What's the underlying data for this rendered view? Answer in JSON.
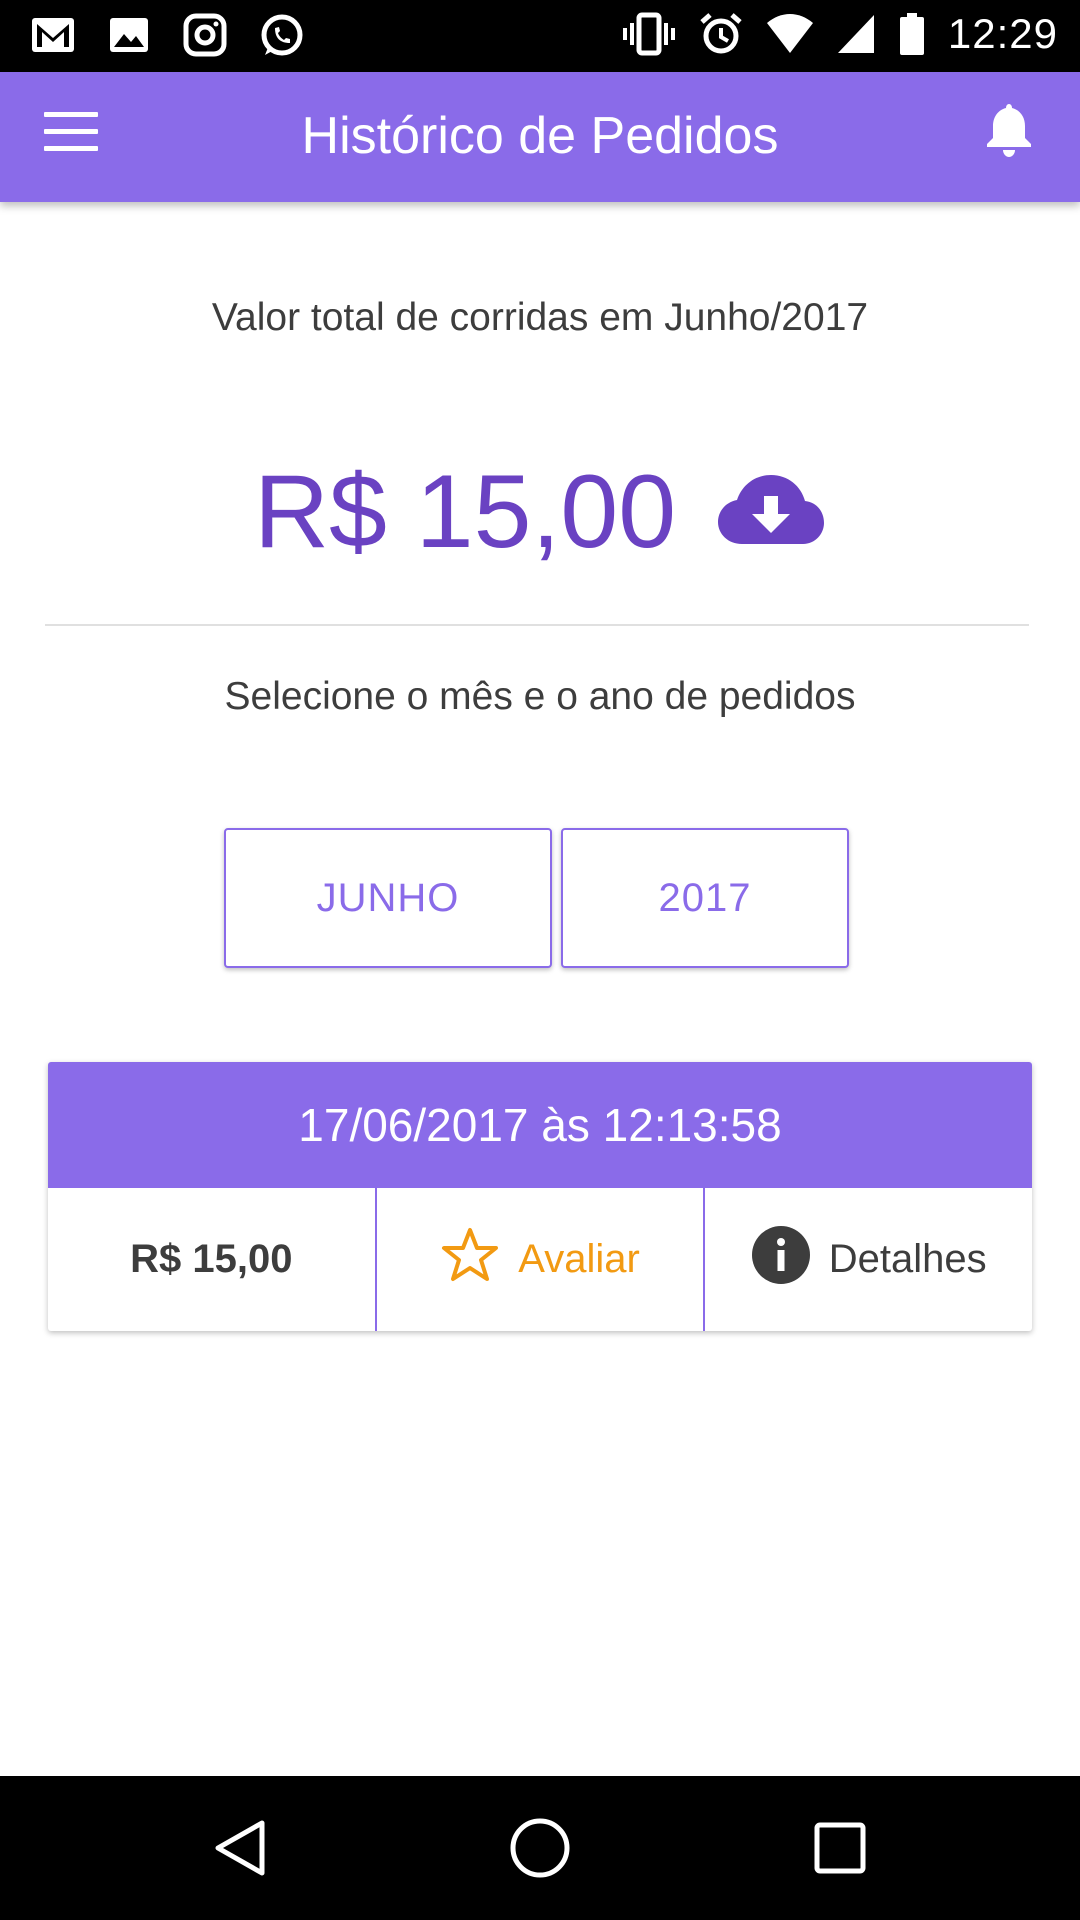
{
  "status_bar": {
    "time": "12:29",
    "left_icons": [
      "gmail-icon",
      "gallery-icon",
      "instagram-icon",
      "whatsapp-icon"
    ],
    "right_icons": [
      "vibrate-icon",
      "alarm-icon",
      "wifi-icon",
      "signal-icon",
      "battery-icon"
    ]
  },
  "app_bar": {
    "title": "Histórico de Pedidos",
    "menu_icon": "hamburger-menu-icon",
    "notification_icon": "bell-icon"
  },
  "summary": {
    "label": "Valor total de corridas em Junho/2017",
    "total": "R$ 15,00",
    "download_icon": "cloud-download-icon"
  },
  "filter": {
    "label": "Selecione o mês e o ano de pedidos",
    "month": "JUNHO",
    "year": "2017"
  },
  "orders": [
    {
      "datetime": "17/06/2017 às 12:13:58",
      "price": "R$ 15,00",
      "rate_label": "Avaliar",
      "details_label": "Detalhes"
    }
  ],
  "colors": {
    "primary": "#8a6be9",
    "primary_dark": "#6a42c2",
    "rate": "#f29a12",
    "text": "#3d3d3d"
  },
  "nav_bar": {
    "icons": [
      "back-icon",
      "home-icon",
      "recent-apps-icon"
    ]
  }
}
